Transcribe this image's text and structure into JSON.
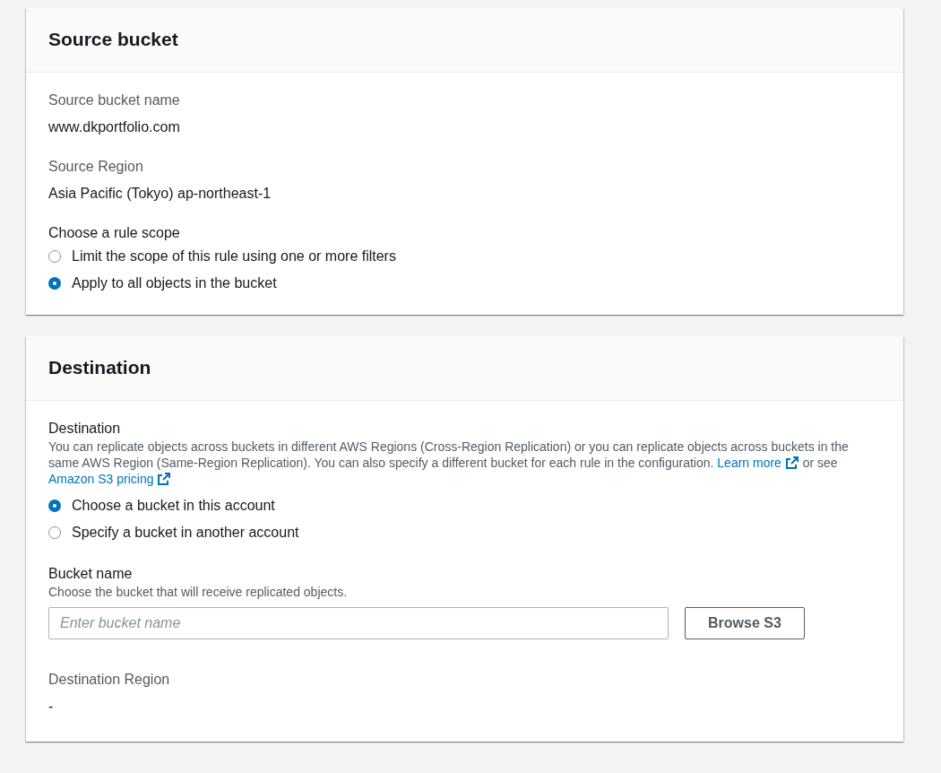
{
  "source_bucket": {
    "title": "Source bucket",
    "fields": [
      {
        "label": "Source bucket name",
        "value": "www.dkportfolio.com"
      },
      {
        "label": "Source Region",
        "value": "Asia Pacific (Tokyo) ap-northeast-1"
      }
    ],
    "rule_scope": {
      "label": "Choose a rule scope",
      "options": [
        {
          "label": "Limit the scope of this rule using one or more filters",
          "selected": false
        },
        {
          "label": "Apply to all objects in the bucket",
          "selected": true
        }
      ]
    }
  },
  "destination": {
    "title": "Destination",
    "label": "Destination",
    "description": [
      {
        "kind": "text",
        "text": "You can replicate objects across buckets in different AWS Regions (Cross-Region Replication) or you can replicate objects across buckets in the same AWS Region (Same-Region Replication). You can also specify a different bucket for each rule in the configuration. "
      },
      {
        "kind": "link",
        "text": "Learn more"
      },
      {
        "kind": "text",
        "text": " or see "
      },
      {
        "kind": "link",
        "text": "Amazon S3 pricing"
      }
    ],
    "options": [
      {
        "label": "Choose a bucket in this account",
        "selected": true
      },
      {
        "label": "Specify a bucket in another account",
        "selected": false
      }
    ],
    "bucket_name": {
      "label": "Bucket name",
      "hint": "Choose the bucket that will receive replicated objects.",
      "placeholder": "Enter bucket name",
      "button": "Browse S3"
    },
    "region": {
      "label": "Destination Region",
      "value": "-"
    }
  }
}
